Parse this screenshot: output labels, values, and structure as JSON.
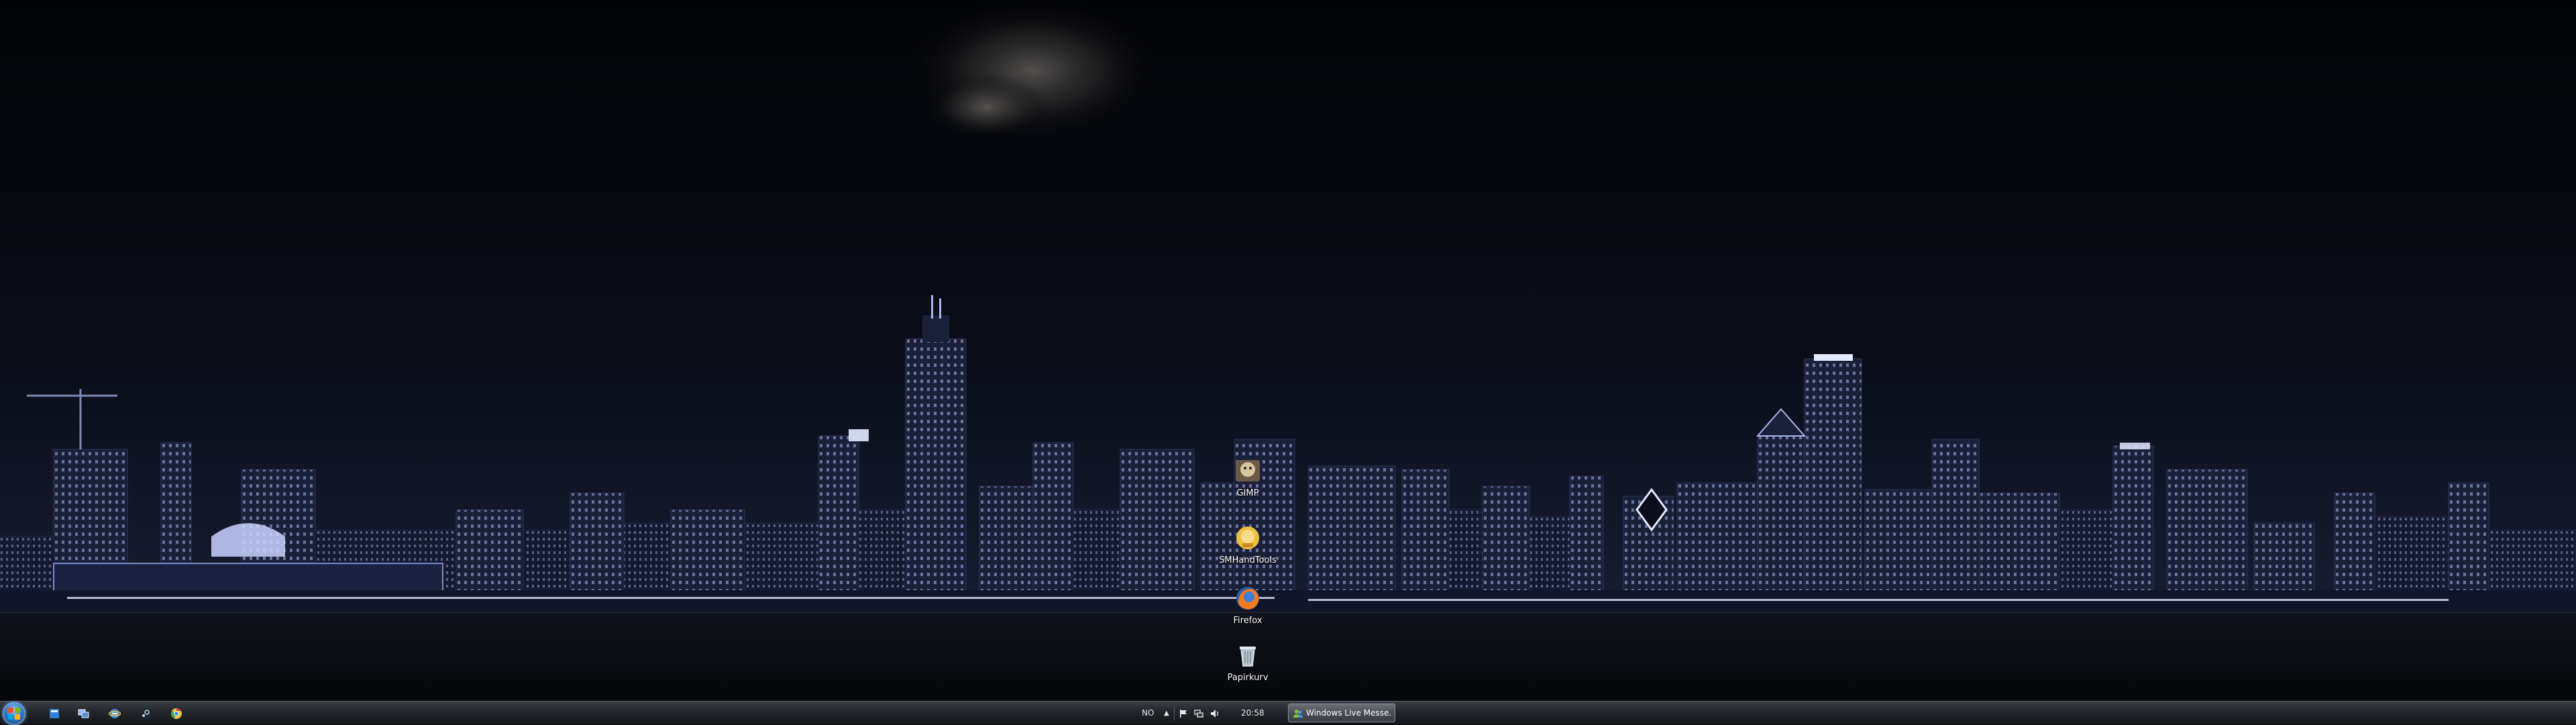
{
  "desktop": {
    "icons": [
      {
        "label": "GIMP",
        "icon": "gimp-icon"
      },
      {
        "label": "SMHandTools",
        "icon": "smhandtools-icon"
      },
      {
        "label": "Firefox",
        "icon": "firefox-icon"
      },
      {
        "label": "Papirkurv",
        "icon": "recycle-bin-icon"
      }
    ]
  },
  "taskbar": {
    "quick_launch": [
      "windows-icon",
      "switch-windows-icon",
      "internet-explorer-icon",
      "steam-icon",
      "chrome-icon"
    ],
    "language": "NO",
    "clock": "20:58",
    "tasks": [
      {
        "label": "Windows Live Messe...",
        "icon": "messenger-icon"
      }
    ]
  },
  "colors": {
    "sky": "#05070d",
    "skyline_light": "#cfd8ff",
    "taskbar": "#23252b"
  }
}
